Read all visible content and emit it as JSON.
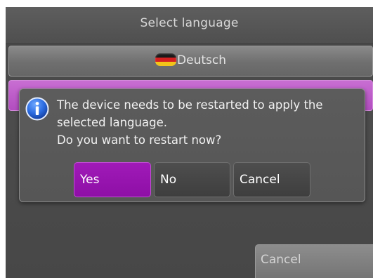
{
  "header": {
    "title": "Select language"
  },
  "language_list": {
    "items": [
      {
        "label": "Deutsch",
        "flag_icon": "germany-flag-icon"
      },
      {
        "label": "",
        "selected": true
      }
    ]
  },
  "dialog": {
    "icon": "info-icon",
    "message_lines": [
      "The device needs to be restarted to apply the",
      "selected language.",
      "Do you want to restart now?"
    ],
    "buttons": {
      "yes": "Yes",
      "no": "No",
      "cancel": "Cancel"
    }
  },
  "footer": {
    "cancel_label": "Cancel"
  },
  "colors": {
    "accent": "#9a14b2",
    "selection": "#b24dc0",
    "info_icon": "#1e5fd0",
    "background": "#4a4a4a"
  }
}
